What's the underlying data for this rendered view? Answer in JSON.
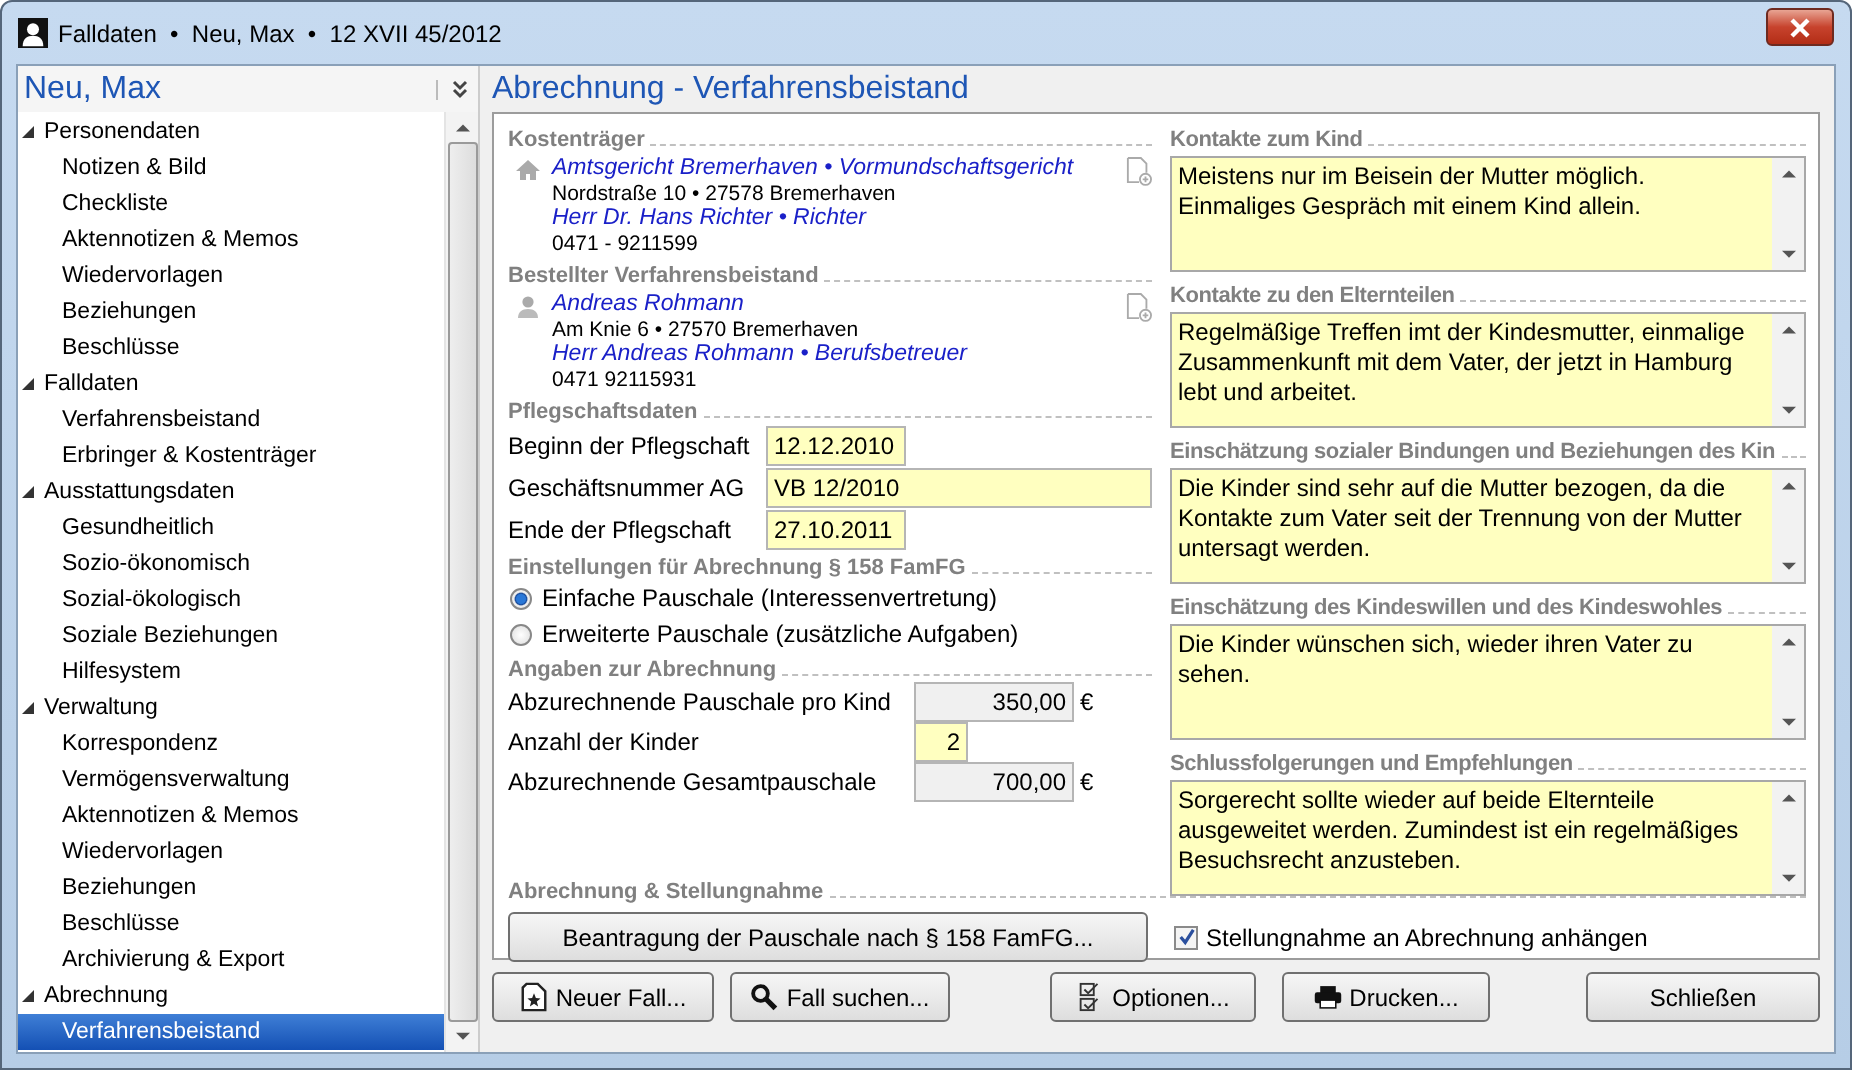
{
  "window": {
    "title": "Falldaten  •  Neu, Max  •  12 XVII 45/2012"
  },
  "sidebar": {
    "title": "Neu, Max",
    "items": [
      {
        "label": "Personendaten",
        "expanded": true,
        "children": [
          {
            "label": "Notizen & Bild",
            "selected": false
          },
          {
            "label": "Checkliste",
            "selected": false
          },
          {
            "label": "Aktennotizen & Memos",
            "selected": false
          },
          {
            "label": "Wiedervorlagen",
            "selected": false
          },
          {
            "label": "Beziehungen",
            "selected": false
          },
          {
            "label": "Beschlüsse",
            "selected": false
          }
        ]
      },
      {
        "label": "Falldaten",
        "expanded": true,
        "children": [
          {
            "label": "Verfahrensbeistand",
            "selected": false
          },
          {
            "label": "Erbringer & Kostenträger",
            "selected": false
          }
        ]
      },
      {
        "label": "Ausstattungsdaten",
        "expanded": true,
        "children": [
          {
            "label": "Gesundheitlich",
            "selected": false
          },
          {
            "label": "Sozio-ökonomisch",
            "selected": false
          },
          {
            "label": "Sozial-ökologisch",
            "selected": false
          },
          {
            "label": "Soziale Beziehungen",
            "selected": false
          },
          {
            "label": "Hilfesystem",
            "selected": false
          }
        ]
      },
      {
        "label": "Verwaltung",
        "expanded": true,
        "children": [
          {
            "label": "Korrespondenz",
            "selected": false
          },
          {
            "label": "Vermögensverwaltung",
            "selected": false
          },
          {
            "label": "Aktennotizen & Memos",
            "selected": false
          },
          {
            "label": "Wiedervorlagen",
            "selected": false
          },
          {
            "label": "Beziehungen",
            "selected": false
          },
          {
            "label": "Beschlüsse",
            "selected": false
          },
          {
            "label": "Archivierung & Export",
            "selected": false
          }
        ]
      },
      {
        "label": "Abrechnung",
        "expanded": true,
        "children": [
          {
            "label": "Verfahrensbeistand",
            "selected": true
          }
        ]
      }
    ]
  },
  "page_title": "Abrechnung - Verfahrensbeistand",
  "contacts": [
    {
      "heading": "Kostenträger",
      "kind": "office",
      "lines": [
        {
          "text": "Amtsgericht Bremerhaven • Vormundschaftsgericht",
          "kind": "link"
        },
        {
          "text": "Nordstraße 10 • 27578 Bremerhaven",
          "kind": "plain"
        },
        {
          "text": "Herr Dr. Hans Richter • Richter",
          "kind": "link"
        },
        {
          "text": "0471 - 9211599",
          "kind": "plain"
        }
      ]
    },
    {
      "heading": "Bestellter Verfahrensbeistand",
      "kind": "person",
      "lines": [
        {
          "text": "Andreas Rohmann",
          "kind": "link"
        },
        {
          "text": "Am Knie 6 • 27570 Bremerhaven",
          "kind": "plain"
        },
        {
          "text": "Herr Andreas Rohmann • Berufsbetreuer",
          "kind": "link"
        },
        {
          "text": "0471 92115931",
          "kind": "plain"
        }
      ]
    }
  ],
  "care_data": {
    "heading": "Pflegschaftsdaten",
    "fields": [
      {
        "label": "Beginn der Pflegschaft",
        "value": "12.12.2010",
        "kind": "short"
      },
      {
        "label": "Geschäftsnummer AG",
        "value": "VB 12/2010",
        "kind": "wide"
      },
      {
        "label": "Ende der Pflegschaft",
        "value": "27.10.2011",
        "kind": "short"
      }
    ]
  },
  "settings": {
    "heading": "Einstellungen für Abrechnung § 158 FamFG",
    "options": [
      {
        "label": "Einfache Pauschale (Interessenvertretung)",
        "selected": true
      },
      {
        "label": "Erweiterte Pauschale (zusätzliche Aufgaben)",
        "selected": false
      }
    ]
  },
  "billing": {
    "heading": "Angaben zur Abrechnung",
    "rows": [
      {
        "label": "Abzurechnende Pauschale pro Kind",
        "value": "350,00",
        "editable": false,
        "unit": "€"
      },
      {
        "label": "Anzahl der Kinder",
        "value": "2",
        "editable": true
      },
      {
        "label": "Abzurechnende Gesamtpauschale",
        "value": "700,00",
        "editable": false,
        "unit": "€"
      }
    ]
  },
  "notes": [
    {
      "heading": "Kontakte zum Kind",
      "text": "Meistens nur im Beisein der Mutter möglich.\nEinmaliges Gespräch mit einem Kind allein."
    },
    {
      "heading": "Kontakte zu den Elternteilen",
      "text": "Regelmäßige Treffen imt der Kindesmutter, einmalige Zusammenkunft mit dem Vater, der jetzt in Hamburg lebt und arbeitet."
    },
    {
      "heading": "Einschätzung sozialer Bindungen und Beziehungen des Kin",
      "text": "Die Kinder sind sehr auf die Mutter bezogen, da die Kontakte zum Vater seit der Trennung von der Mutter untersagt werden."
    },
    {
      "heading": "Einschätzung des Kindeswillen und des Kindeswohles",
      "text": "Die Kinder wünschen sich, wieder ihren Vater zu sehen."
    },
    {
      "heading": "Schlussfolgerungen und Empfehlungen",
      "text": "Sorgerecht sollte wieder auf beide Elternteile ausgeweitet werden. Zumindest ist ein regelmäßiges Besuchsrecht anzusteben."
    }
  ],
  "statement": {
    "heading": "Abrechnung & Stellungnahme",
    "button": "Beantragung der Pauschale nach § 158 FamFG...",
    "checkbox": {
      "label": "Stellungnahme an Abrechnung anhängen",
      "checked": true
    }
  },
  "buttons": [
    {
      "label": "Neuer Fall...",
      "kind": "new"
    },
    {
      "label": "Fall suchen...",
      "kind": "search"
    },
    {
      "label": "Optionen...",
      "kind": "options"
    },
    {
      "label": "Drucken...",
      "kind": "print"
    },
    {
      "label": "Schließen",
      "kind": "close"
    }
  ]
}
